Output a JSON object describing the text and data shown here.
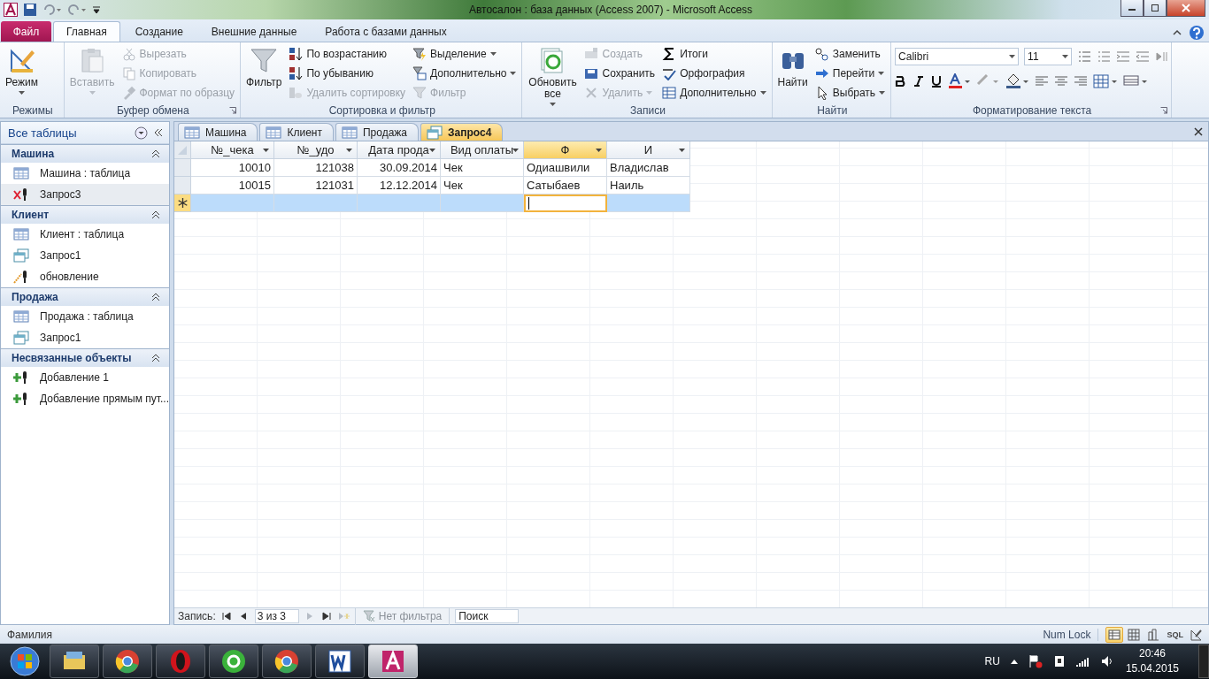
{
  "window": {
    "title": "Автосалон : база данных (Access 2007)  -  Microsoft Access"
  },
  "ribbon": {
    "tabs": [
      {
        "label": "Файл",
        "kind": "file",
        "selected": false
      },
      {
        "label": "Главная",
        "kind": "tab",
        "selected": true
      },
      {
        "label": "Создание",
        "kind": "tab",
        "selected": false
      },
      {
        "label": "Внешние данные",
        "kind": "tab",
        "selected": false
      },
      {
        "label": "Работа с базами данных",
        "kind": "tab",
        "selected": false
      }
    ],
    "groups": [
      {
        "label": "Режимы",
        "kind": "commands",
        "launcher": false,
        "large": [
          {
            "label": "Режим",
            "dropdown": true,
            "disabled": false
          }
        ]
      },
      {
        "label": "Буфер обмена",
        "kind": "commands",
        "launcher": true,
        "large": [
          {
            "label": "Вставить",
            "dropdown": true,
            "disabled": true
          }
        ],
        "columns": [
          [
            {
              "label": "Вырезать",
              "dropdown": false,
              "disabled": true
            },
            {
              "label": "Копировать",
              "dropdown": false,
              "disabled": true
            },
            {
              "label": "Формат по образцу",
              "dropdown": false,
              "disabled": true
            }
          ]
        ]
      },
      {
        "label": "Сортировка и фильтр",
        "kind": "commands",
        "launcher": false,
        "large": [
          {
            "label": "Фильтр",
            "dropdown": false,
            "disabled": false
          }
        ],
        "columns": [
          [
            {
              "label": "По возрастанию",
              "dropdown": false,
              "disabled": false
            },
            {
              "label": "По убыванию",
              "dropdown": false,
              "disabled": false
            },
            {
              "label": "Удалить сортировку",
              "dropdown": false,
              "disabled": true
            }
          ],
          [
            {
              "label": "Выделение",
              "dropdown": true,
              "disabled": false
            },
            {
              "label": "Дополнительно",
              "dropdown": true,
              "disabled": false
            },
            {
              "label": "Фильтр",
              "dropdown": false,
              "disabled": true
            }
          ]
        ]
      },
      {
        "label": "Записи",
        "kind": "commands",
        "launcher": false,
        "large": [
          {
            "label": "Обновить все",
            "dropdown": true,
            "disabled": false
          }
        ],
        "columns": [
          [
            {
              "label": "Создать",
              "dropdown": false,
              "disabled": true
            },
            {
              "label": "Сохранить",
              "dropdown": false,
              "disabled": false
            },
            {
              "label": "Удалить",
              "dropdown": true,
              "disabled": true
            }
          ],
          [
            {
              "label": "Итоги",
              "dropdown": false,
              "disabled": false
            },
            {
              "label": "Орфография",
              "dropdown": false,
              "disabled": false
            },
            {
              "label": "Дополнительно",
              "dropdown": true,
              "disabled": false
            }
          ]
        ]
      },
      {
        "label": "Найти",
        "kind": "commands",
        "launcher": false,
        "large": [
          {
            "label": "Найти",
            "dropdown": false,
            "disabled": false
          }
        ],
        "columns": [
          [
            {
              "label": "Заменить",
              "dropdown": false,
              "disabled": false
            },
            {
              "label": "Перейти",
              "dropdown": true,
              "disabled": false
            },
            {
              "label": "Выбрать",
              "dropdown": true,
              "disabled": false
            }
          ]
        ]
      },
      {
        "label": "Форматирование текста",
        "kind": "format",
        "launcher": true,
        "font": "Calibri",
        "size": "11"
      }
    ]
  },
  "navigation": {
    "title": "Все таблицы",
    "groups": [
      {
        "title": "Машина",
        "expanded": true,
        "items": [
          {
            "label": "Машина : таблица",
            "kind": "table",
            "selected": false
          },
          {
            "label": "Запрос3",
            "kind": "make-table",
            "selected": true
          }
        ]
      },
      {
        "title": "Клиент",
        "expanded": true,
        "items": [
          {
            "label": "Клиент : таблица",
            "kind": "table",
            "selected": false
          },
          {
            "label": "Запрос1",
            "kind": "select",
            "selected": false
          },
          {
            "label": "обновление",
            "kind": "update",
            "selected": false
          }
        ]
      },
      {
        "title": "Продажа",
        "expanded": true,
        "items": [
          {
            "label": "Продажа : таблица",
            "kind": "table",
            "selected": false
          },
          {
            "label": "Запрос1",
            "kind": "select",
            "selected": false
          }
        ]
      },
      {
        "title": "Несвязанные объекты",
        "expanded": true,
        "items": [
          {
            "label": "Добавление 1",
            "kind": "append",
            "selected": false
          },
          {
            "label": "Добавление прямым пут...",
            "kind": "append",
            "selected": false
          }
        ]
      }
    ]
  },
  "documents": [
    {
      "label": "Машина",
      "kind": "table",
      "selected": false
    },
    {
      "label": "Клиент",
      "kind": "table",
      "selected": false
    },
    {
      "label": "Продажа",
      "kind": "table",
      "selected": false
    },
    {
      "label": "Запрос4",
      "kind": "query",
      "selected": true
    }
  ],
  "datasheet": {
    "columns": [
      {
        "label": "№_чека",
        "kind": "number",
        "selected": false
      },
      {
        "label": "№_удо",
        "kind": "number",
        "selected": false
      },
      {
        "label": "Дата прода",
        "kind": "number",
        "selected": false
      },
      {
        "label": "Вид оплаты",
        "kind": "text",
        "selected": false
      },
      {
        "label": "Ф",
        "kind": "text",
        "selected": true
      },
      {
        "label": "И",
        "kind": "text",
        "selected": false
      }
    ],
    "rows": [
      {
        "cells": [
          "10010",
          "121038",
          "30.09.2014",
          "Чек",
          "Одиашвили",
          "Владислав"
        ]
      },
      {
        "cells": [
          "10015",
          "121031",
          "12.12.2014",
          "Чек",
          "Сатыбаев",
          "Наиль"
        ]
      }
    ],
    "new_row": {
      "selected": true
    }
  },
  "record_navigator": {
    "label": "Запись:",
    "position": "3 из 3",
    "buttons": [
      {
        "kind": "first",
        "disabled": false
      },
      {
        "kind": "prev",
        "disabled": false
      },
      {
        "kind": "next",
        "disabled": true
      },
      {
        "kind": "last",
        "disabled": false
      },
      {
        "kind": "new",
        "disabled": true
      }
    ],
    "filter": {
      "label": "Нет фильтра",
      "disabled": true
    },
    "search": {
      "placeholder": "Поиск"
    }
  },
  "status_bar": {
    "text": "Фамилия",
    "indicator": "Num Lock",
    "views": [
      {
        "kind": "datasheet",
        "selected": true
      },
      {
        "kind": "pivot-table",
        "selected": false
      },
      {
        "kind": "pivot-chart",
        "selected": false
      },
      {
        "kind": "sql",
        "label": "SQL",
        "selected": false
      },
      {
        "kind": "design",
        "selected": false
      }
    ]
  },
  "taskbar": {
    "apps": [
      {
        "kind": "explorer",
        "active": false
      },
      {
        "kind": "chrome",
        "active": false
      },
      {
        "kind": "opera",
        "active": false
      },
      {
        "kind": "agent",
        "active": false
      },
      {
        "kind": "chrome",
        "active": false
      },
      {
        "kind": "word",
        "active": false
      },
      {
        "kind": "access",
        "active": true
      }
    ],
    "language": "RU",
    "time": "20:46",
    "date": "15.04.2015"
  }
}
